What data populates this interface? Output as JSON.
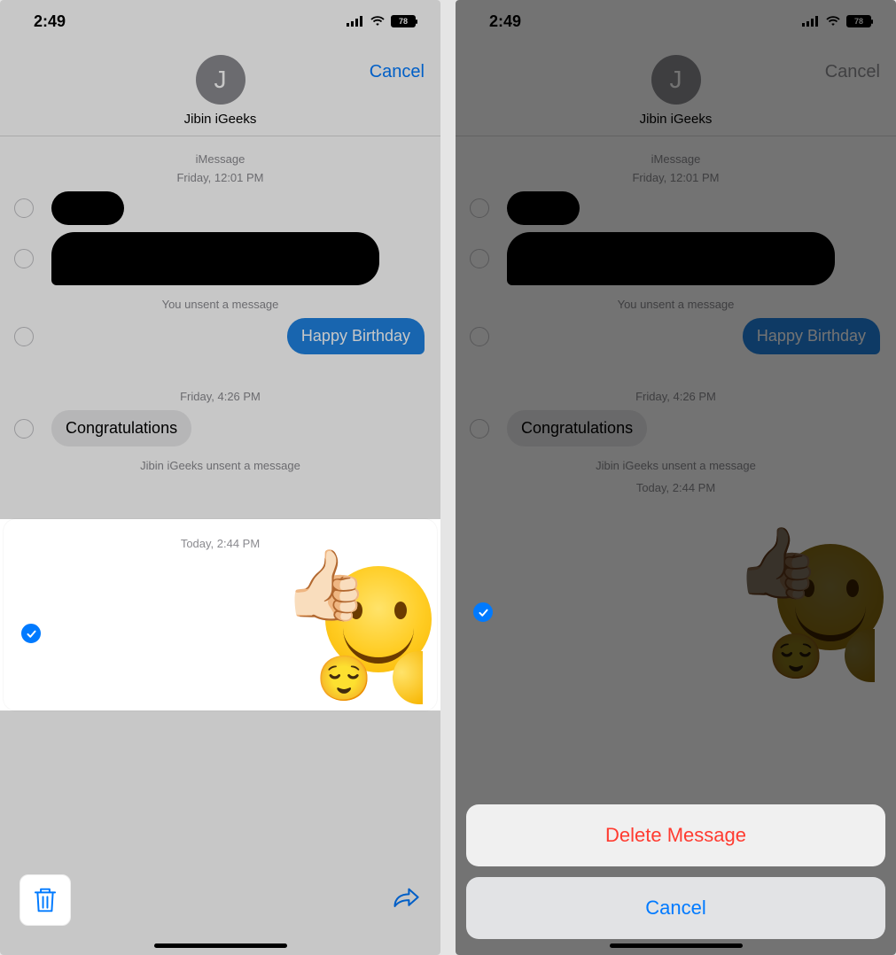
{
  "status": {
    "time": "2:49",
    "battery": "78"
  },
  "header": {
    "avatar_initial": "J",
    "contact_name": "Jibin iGeeks",
    "cancel_label": "Cancel"
  },
  "thread": {
    "service_label": "iMessage",
    "timestamp1": "Friday, 12:01 PM",
    "unsent_self": "You unsent a message",
    "happy_birthday": "Happy Birthday",
    "timestamp2": "Friday, 4:26 PM",
    "congratulations": "Congratulations",
    "unsent_other": "Jibin iGeeks unsent a message",
    "timestamp3": "Today, 2:44 PM"
  },
  "action_sheet": {
    "delete_label": "Delete Message",
    "cancel_label": "Cancel"
  },
  "icons": {
    "signal": "signal-icon",
    "wifi": "wifi-icon",
    "battery": "battery-icon",
    "trash": "trash-icon",
    "share": "share-icon",
    "checkmark": "checkmark-icon"
  }
}
